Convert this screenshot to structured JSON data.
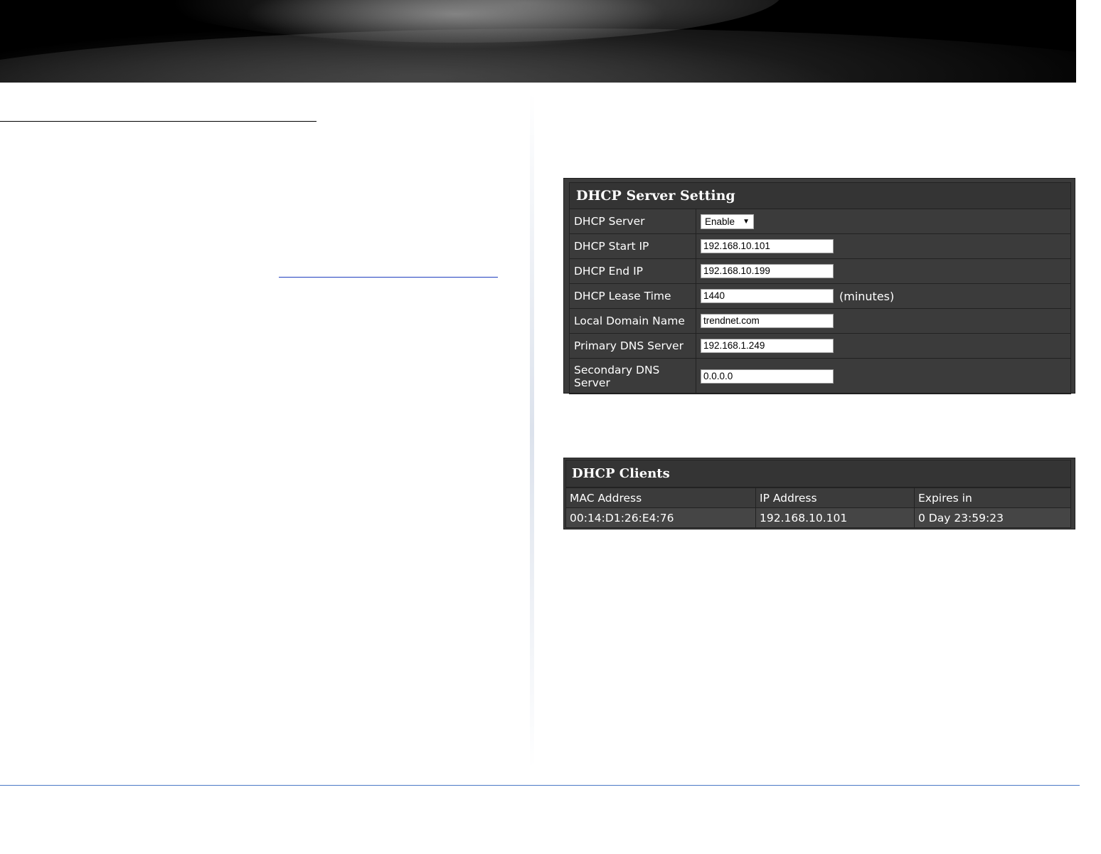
{
  "dhcp_server_setting": {
    "title": "DHCP Server Setting",
    "rows": {
      "dhcp_server": {
        "label": "DHCP Server",
        "value": "Enable"
      },
      "start_ip": {
        "label": "DHCP Start IP",
        "value": "192.168.10.101"
      },
      "end_ip": {
        "label": "DHCP End IP",
        "value": "192.168.10.199"
      },
      "lease_time": {
        "label": "DHCP Lease Time",
        "value": "1440",
        "unit": "(minutes)"
      },
      "domain_name": {
        "label": "Local Domain Name",
        "value": "trendnet.com"
      },
      "primary_dns": {
        "label": "Primary DNS Server",
        "value": "192.168.1.249"
      },
      "secondary_dns": {
        "label": "Secondary DNS Server",
        "value": "0.0.0.0"
      }
    },
    "dhcp_server_options": [
      "Enable"
    ]
  },
  "dhcp_clients": {
    "title": "DHCP Clients",
    "columns": [
      "MAC Address",
      "IP Address",
      "Expires in"
    ],
    "rows": [
      [
        "00:14:D1:26:E4:76",
        "192.168.10.101",
        "0 Day 23:59:23"
      ]
    ]
  },
  "icons": {
    "select_arrow": "chevron-down-icon"
  },
  "colors": {
    "panel_bg": "#3b3b3b",
    "panel_title_bg": "#343434",
    "divider_blue": "#4a78c6",
    "link_blue": "#1f3fbf"
  }
}
